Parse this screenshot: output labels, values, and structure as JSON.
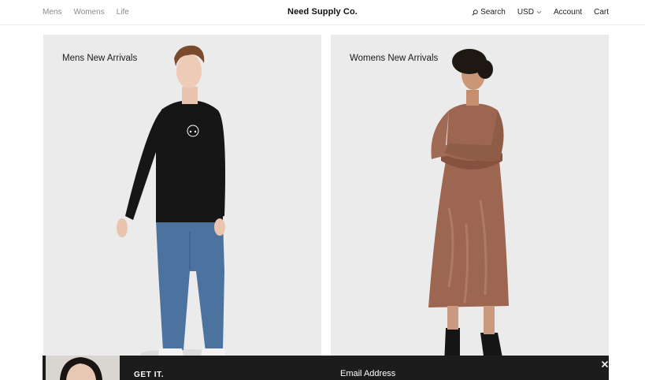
{
  "header": {
    "nav_left": [
      "Mens",
      "Womens",
      "Life"
    ],
    "brand": "Need Supply Co.",
    "search_label": "Search",
    "currency_label": "USD",
    "account_label": "Account",
    "cart_label": "Cart"
  },
  "panels": [
    {
      "title": "Mens New Arrivals"
    },
    {
      "title": "Womens New Arrivals"
    }
  ],
  "signup": {
    "headline": "GET IT.",
    "email_label": "Email Address"
  },
  "colors": {
    "panel_bg": "#ebebeb",
    "bar_bg": "#1c1c1c",
    "nav_muted": "#8a8a8a"
  }
}
